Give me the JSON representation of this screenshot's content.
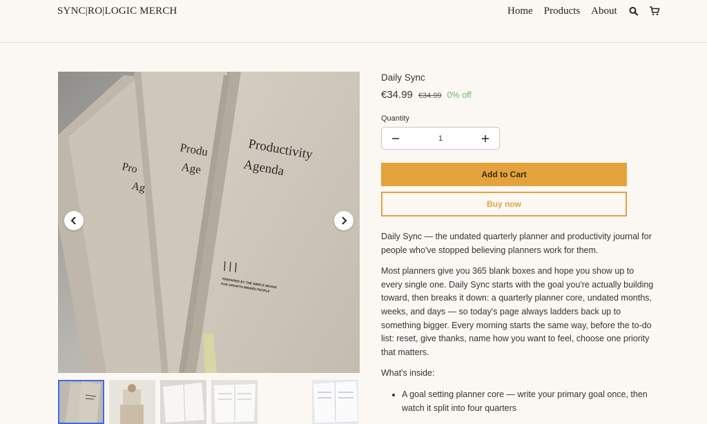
{
  "header": {
    "logo": "SYNC|RO|LOGIC MERCH",
    "nav": [
      "Home",
      "Products",
      "About"
    ],
    "icons": [
      "search-icon",
      "cart-icon"
    ]
  },
  "gallery": {
    "book_cover_text": [
      "Productivity",
      "Agenda"
    ],
    "book_cover_text_partial": [
      "Produ",
      "Age",
      "Pro",
      "Ag"
    ],
    "book_tagline": [
      "PREPARED BY THE SIMPLE BRAND",
      "FOR GROWTH MINDED PEOPLE"
    ],
    "thumbnails_count": 5,
    "active_thumbnail": 0
  },
  "product": {
    "title": "Daily Sync",
    "price": "€34.99",
    "compare_price": "€34.99",
    "discount": "0% off",
    "quantity_label": "Quantity",
    "quantity": "1",
    "add_to_cart": "Add to Cart",
    "buy_now": "Buy now",
    "description": {
      "intro": "Daily Sync — the undated quarterly planner and productivity journal for people who've stopped believing planners work for them.",
      "body": "Most planners give you 365 blank boxes and hope you show up to every single one. Daily Sync starts with the goal you're actually building toward, then breaks it down: a quarterly planner core, undated months, weeks, and days — so today's page always ladders back up to something bigger. Every morning starts the same way, before the to-do list: reset, give thanks, name how you want to feel, choose one priority that matters.",
      "whats_inside_label": "What's inside:",
      "items": [
        "A goal setting planner core — write your primary goal once, then watch it split into four quarters"
      ]
    }
  },
  "colors": {
    "accent": "#e3a23c",
    "discount": "#6dbb6d",
    "background": "#fbf8f4"
  }
}
